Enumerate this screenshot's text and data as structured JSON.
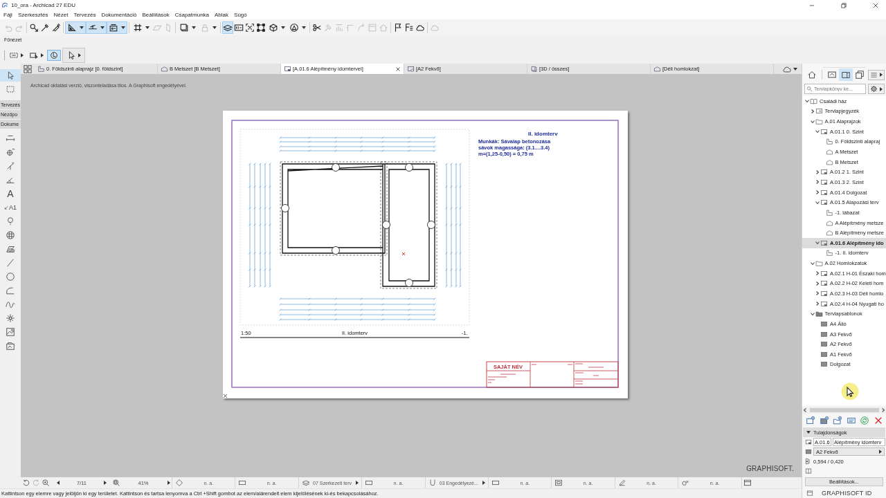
{
  "window": {
    "title": "10_ora - Archicad 27 EDU"
  },
  "menu": [
    "Fájl",
    "Szerkesztés",
    "Nézet",
    "Tervezés",
    "Dokumentáció",
    "Beállítások",
    "Csapatmunka",
    "Ablak",
    "Súgó"
  ],
  "toolbar": [
    {
      "on": false,
      "disabled": true
    },
    {
      "on": false,
      "disabled": true
    },
    {
      "on": false,
      "disabled": false
    },
    {
      "on": false,
      "disabled": false
    },
    {
      "on": false,
      "disabled": false
    },
    {
      "on": true,
      "disabled": false
    },
    {
      "on": true,
      "disabled": false
    },
    {
      "on": true,
      "disabled": false
    },
    {
      "on": false,
      "disabled": false
    },
    {
      "on": false,
      "disabled": true
    },
    {
      "on": false,
      "disabled": true
    },
    {
      "on": false,
      "disabled": false
    },
    {
      "on": false,
      "disabled": true
    },
    {
      "on": true,
      "disabled": false
    },
    {
      "on": false,
      "disabled": false
    },
    {
      "on": false,
      "disabled": false
    },
    {
      "on": false,
      "disabled": false
    },
    {
      "on": false,
      "disabled": false
    },
    {
      "on": false,
      "disabled": false
    },
    {
      "on": false,
      "disabled": false
    },
    {
      "on": false,
      "disabled": true
    },
    {
      "on": false,
      "disabled": true
    },
    {
      "on": false,
      "disabled": true
    },
    {
      "on": false,
      "disabled": true
    },
    {
      "on": false,
      "disabled": true
    },
    {
      "on": false,
      "disabled": true
    },
    {
      "on": false,
      "disabled": false
    },
    {
      "on": false,
      "disabled": false
    },
    {
      "on": false,
      "disabled": false
    },
    {
      "on": false,
      "disabled": true
    }
  ],
  "info_box": {
    "title": "Főnézet",
    "buttons": [
      {
        "selected": false
      },
      {
        "selected": false
      },
      {
        "selected": true
      },
      {
        "selected": false
      }
    ]
  },
  "tabs": [
    {
      "label": "0. Földszinti alaprajz [0. földszint]",
      "kind": "plan",
      "selected": false
    },
    {
      "label": "B Metszet [B Metszet]",
      "kind": "section",
      "selected": false
    },
    {
      "label": "[A.01.6 Alépítmény idomtervei]",
      "kind": "layout",
      "selected": true
    },
    {
      "label": "[A2 Fekvő]",
      "kind": "master",
      "selected": false
    },
    {
      "label": "[3D / összes]",
      "kind": "model",
      "selected": false
    },
    {
      "label": "[Déli homlokzat]",
      "kind": "elevation",
      "selected": false
    }
  ],
  "toolbox": {
    "top_tools": [
      {
        "selected": true
      },
      {
        "selected": false
      }
    ],
    "sections": [
      "Tervezés",
      "Nézőpo",
      "Dokume"
    ],
    "tools": [
      {
        "kind": "icon",
        "selected": false
      },
      {
        "kind": "icon",
        "selected": false
      },
      {
        "kind": "icon",
        "selected": false
      },
      {
        "kind": "icon",
        "selected": false
      },
      {
        "kind": "glyph",
        "text": "A",
        "selected": false
      },
      {
        "kind": "label",
        "text": "A1",
        "selected": false
      },
      {
        "kind": "icon",
        "selected": false
      },
      {
        "kind": "icon",
        "selected": false
      },
      {
        "kind": "icon",
        "selected": false
      },
      {
        "kind": "icon",
        "selected": false
      },
      {
        "kind": "icon",
        "selected": false
      },
      {
        "kind": "icon",
        "selected": false
      },
      {
        "kind": "icon",
        "selected": false
      },
      {
        "kind": "icon",
        "selected": false
      },
      {
        "kind": "icon",
        "selected": false
      },
      {
        "kind": "icon",
        "selected": false
      }
    ]
  },
  "canvas": {
    "notice": "Archicad oktatási verzió, viszonteladása tilos. A Graphisoft engedélyével.",
    "sheet": {
      "drawing_title": "II. idomterv",
      "note": [
        "Munkák: Sávalap betonozása",
        "sávok magassága: (3.1....3.4)",
        "m=(1,25-0,50) = 0,75 m"
      ],
      "scale": "1:50",
      "caption": "II. idomterv",
      "right_label": "-1.",
      "title_block": {
        "name": "SAJÁT NÉV"
      }
    },
    "logo": "GRAPHISOFT."
  },
  "nav_bar": {
    "page": "7/11",
    "zoom": "41%",
    "fields": [
      {
        "value": "n. a.",
        "kind": "value"
      },
      {
        "value": "n. a.",
        "kind": "value"
      },
      {
        "value": "07 Szerkezeti terv",
        "kind": "menu"
      },
      {
        "value": "n. a.",
        "kind": "value"
      },
      {
        "value": "03 Engedélyezé...",
        "kind": "menu"
      },
      {
        "value": "n. a.",
        "kind": "value"
      },
      {
        "value": "n. a.",
        "kind": "value"
      },
      {
        "value": "n. a.",
        "kind": "value"
      },
      {
        "value": "n. a.",
        "kind": "value"
      }
    ]
  },
  "status_bar": "Kattintson egy elemre vagy jelöljön ki egy területet. Kattintson és tartsa lenyomva a Ctrl +Shift gombot az elem/alárendelt elem kijelölésének ki-és bekapcsolásához.",
  "navigator": {
    "view_buttons": [
      {
        "selected": false
      },
      {
        "selected": false
      },
      {
        "selected": true
      },
      {
        "selected": false
      }
    ],
    "search": {
      "placeholder": "Tervlapkönyv ke..."
    },
    "tree": [
      {
        "label": "Családi ház",
        "kind": "project",
        "expanded": true,
        "selected": false,
        "children": [
          {
            "label": "Tervlapjegyzék",
            "kind": "index",
            "expanded": false,
            "selected": false
          },
          {
            "label": "A.01 Alaprajzok",
            "kind": "folder",
            "expanded": true,
            "selected": false,
            "children": [
              {
                "label": "A.01.1 0. Szint",
                "kind": "layout",
                "expanded": true,
                "selected": false,
                "children": [
                  {
                    "label": "0. Földszinti alapraj",
                    "kind": "plan",
                    "selected": false
                  },
                  {
                    "label": "A Metszet",
                    "kind": "section",
                    "selected": false
                  },
                  {
                    "label": "B Metszet",
                    "kind": "section",
                    "selected": false
                  }
                ]
              },
              {
                "label": "A.01.2 1. Szint",
                "kind": "layout",
                "expanded": false,
                "selected": false
              },
              {
                "label": "A.01.3 2. Szint",
                "kind": "layout",
                "expanded": false,
                "selected": false
              },
              {
                "label": "A.01.4 Dolgozat",
                "kind": "layout",
                "expanded": false,
                "selected": false
              },
              {
                "label": "A.01.5 Alapozási terv",
                "kind": "layout",
                "expanded": true,
                "selected": false,
                "children": [
                  {
                    "label": "-1. lábazat",
                    "kind": "plan",
                    "selected": false
                  },
                  {
                    "label": "A Alépítmény metsze",
                    "kind": "section",
                    "selected": false
                  },
                  {
                    "label": "B Alépítmény metsze",
                    "kind": "section",
                    "selected": false
                  }
                ]
              },
              {
                "label": "A.01.6 Alépítmény ido",
                "kind": "layout",
                "expanded": true,
                "selected": true,
                "children": [
                  {
                    "label": "-1. II. idomterv",
                    "kind": "plan",
                    "selected": false
                  }
                ]
              }
            ]
          },
          {
            "label": "A.02 Homlokzatok",
            "kind": "folder",
            "expanded": true,
            "selected": false,
            "children": [
              {
                "label": "A.02.1 H-01 Északi hom",
                "kind": "layout",
                "expanded": false,
                "selected": false
              },
              {
                "label": "A.02.2 H-02 Keleti hom",
                "kind": "layout",
                "expanded": false,
                "selected": false
              },
              {
                "label": "A.02.3 H-03 Déli homlo",
                "kind": "layout",
                "expanded": false,
                "selected": false
              },
              {
                "label": "A.02.4 H-04 Nyugati ho",
                "kind": "layout",
                "expanded": false,
                "selected": false
              }
            ]
          },
          {
            "label": "Tervlapsablonok",
            "kind": "masters",
            "expanded": true,
            "selected": false,
            "children": [
              {
                "label": "A4 Álló",
                "kind": "master",
                "selected": false
              },
              {
                "label": "A3 Fekvő",
                "kind": "master",
                "selected": false
              },
              {
                "label": "A2 Fekvő",
                "kind": "master",
                "selected": false
              },
              {
                "label": "A1 Fekvő",
                "kind": "master",
                "selected": false
              },
              {
                "label": "Dolgozat",
                "kind": "master",
                "selected": false
              }
            ]
          }
        ]
      }
    ],
    "properties": {
      "title": "Tulajdonságok",
      "id": "A.01.6",
      "name": "Alépítmény idomterv",
      "master": "A2 Fekvő",
      "size": "0,594 / 0,420"
    },
    "settings_button": "Beállítások...",
    "footer": "GRAPHISOFT ID"
  }
}
